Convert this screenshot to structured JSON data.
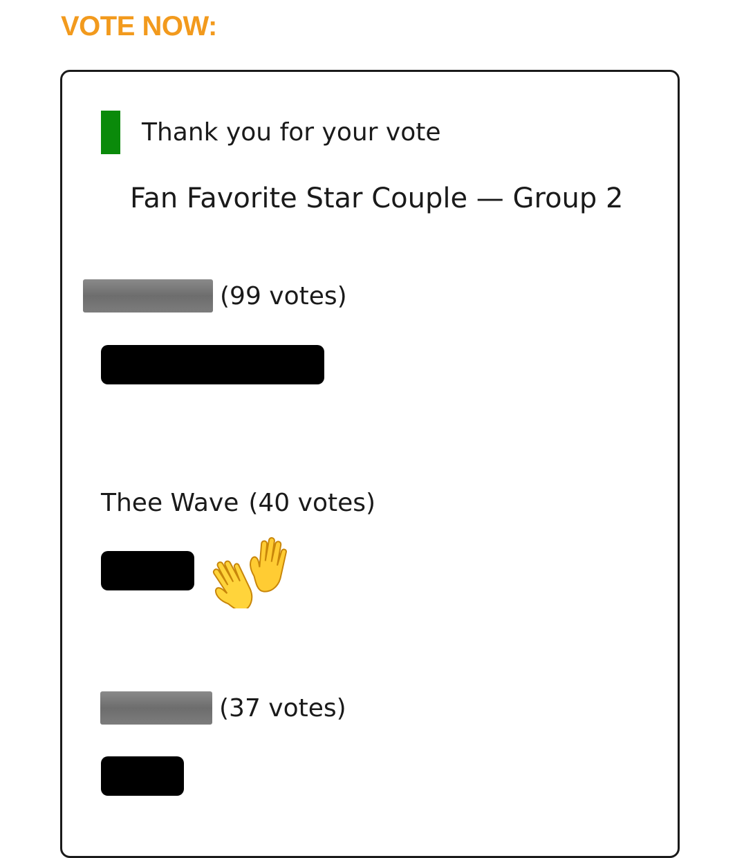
{
  "heading": "VOTE NOW:",
  "confirmation": "Thank you for your vote",
  "poll_title": "Fan Favorite Star Couple — Group 2",
  "options": [
    {
      "name": "",
      "votes_label": "(99 votes)",
      "votes": 99,
      "name_redacted": true
    },
    {
      "name": "Thee Wave",
      "votes_label": "(40 votes)",
      "votes": 40,
      "name_redacted": false,
      "emoji": "raised-hands-icon"
    },
    {
      "name": "",
      "votes_label": "(37 votes)",
      "votes": 37,
      "name_redacted": true
    }
  ],
  "colors": {
    "heading": "#f29a1d",
    "confirmation_accent": "#0a8a0a",
    "bar": "#000000"
  }
}
